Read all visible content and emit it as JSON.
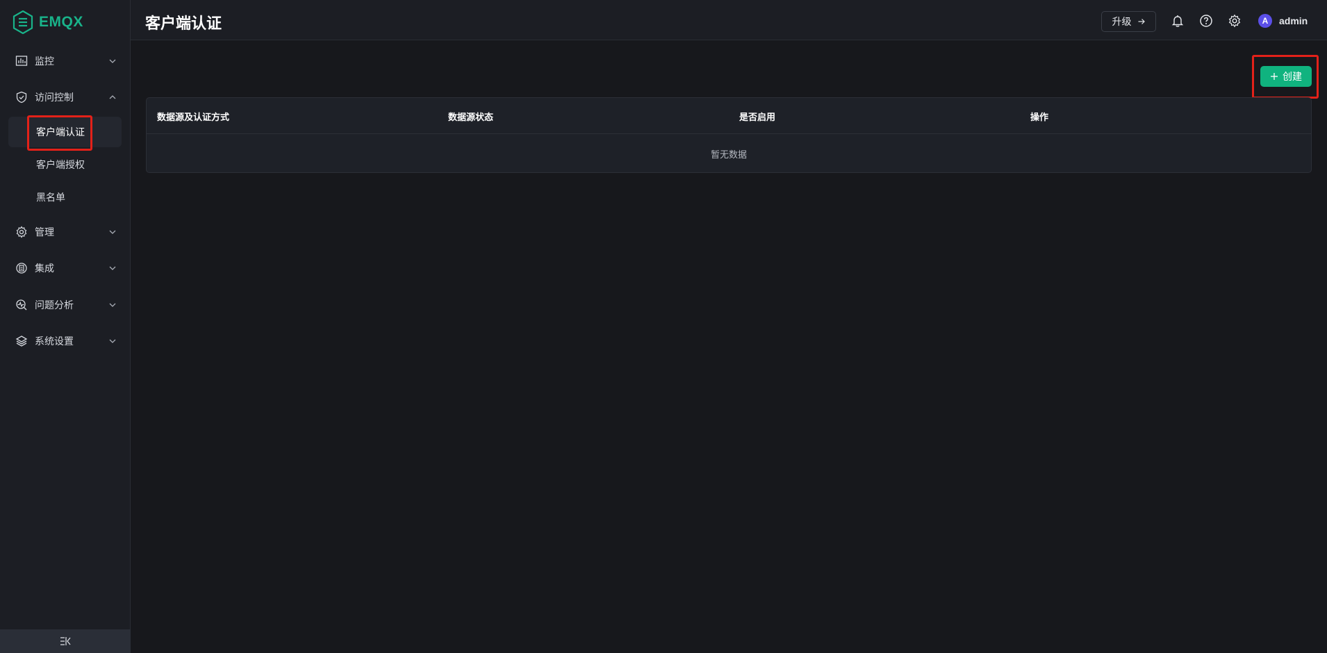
{
  "app": {
    "logo_text": "EMQX",
    "brand_color": "#19b38a"
  },
  "sidebar": {
    "items": [
      {
        "label": "监控",
        "icon": "chart-icon"
      },
      {
        "label": "访问控制",
        "icon": "shield-icon",
        "expanded": true
      },
      {
        "label": "管理",
        "icon": "gear-icon"
      },
      {
        "label": "集成",
        "icon": "integration-icon"
      },
      {
        "label": "问题分析",
        "icon": "diagnose-icon"
      },
      {
        "label": "系统设置",
        "icon": "layers-icon"
      }
    ],
    "sub_items": [
      {
        "label": "客户端认证",
        "active": true
      },
      {
        "label": "客户端授权"
      },
      {
        "label": "黑名单"
      }
    ]
  },
  "header": {
    "title": "客户端认证",
    "upgrade_label": "升级",
    "user": {
      "avatar_letter": "A",
      "name": "admin"
    }
  },
  "main": {
    "create_label": "创建",
    "table": {
      "columns": [
        "数据源及认证方式",
        "数据源状态",
        "是否启用",
        "操作"
      ],
      "empty_text": "暂无数据"
    }
  },
  "colors": {
    "accent": "#10b37f",
    "highlight": "#e32119",
    "avatar": "#5b4fe8"
  }
}
